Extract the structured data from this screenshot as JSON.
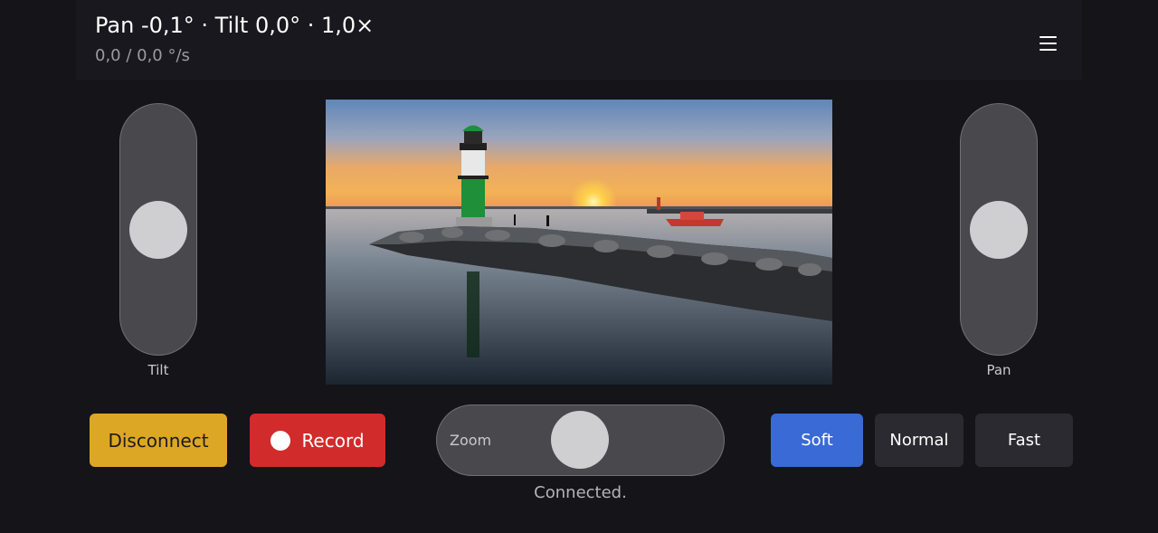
{
  "header": {
    "title": "Pan -0,1° · Tilt 0,0° · 1,0×",
    "subtitle": "0,0 / 0,0 °/s"
  },
  "tilt": {
    "label": "Tilt",
    "value": 0.5
  },
  "pan": {
    "label": "Pan",
    "value": 0.5
  },
  "zoom": {
    "label": "Zoom",
    "value": 0.5
  },
  "buttons": {
    "disconnect": "Disconnect",
    "record": "Record"
  },
  "speed": {
    "options": [
      "Soft",
      "Normal",
      "Fast"
    ],
    "selected": "Soft"
  },
  "status": "Connected.",
  "colors": {
    "background": "#141419",
    "disconnect": "#dda726",
    "record": "#d22b2b",
    "selected_speed": "#3a6ad6",
    "speed_button": "#2a2a30",
    "slider_track": "#48484d",
    "slider_knob": "#cfcfd1"
  },
  "icons": {
    "menu": "hamburger-menu-icon",
    "record": "record-dot-icon"
  }
}
